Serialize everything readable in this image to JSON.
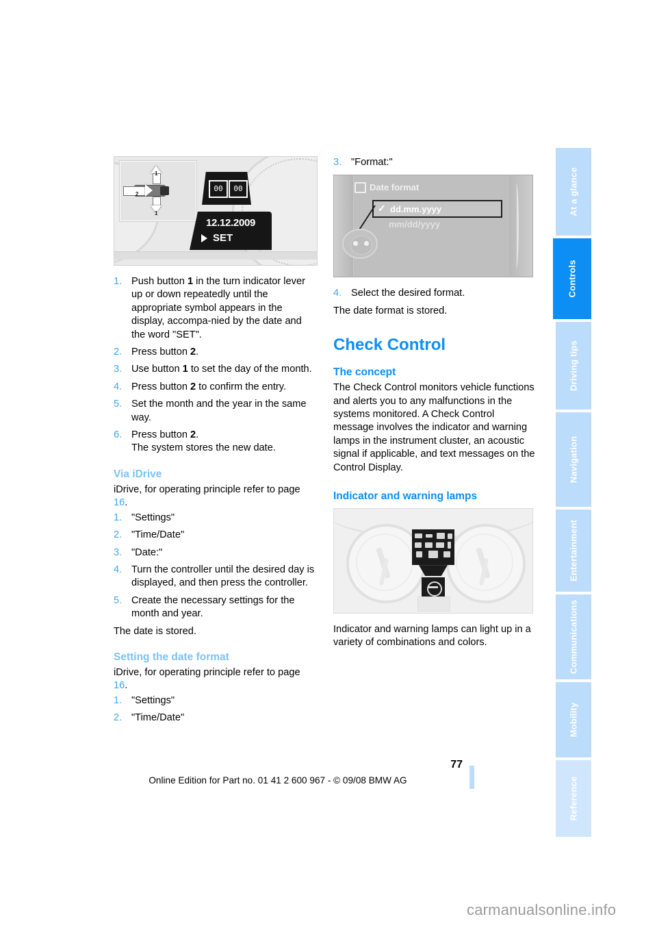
{
  "document": {
    "page_number": "77",
    "footer_text": "Online Edition for Part no. 01 41 2 600 967  - © 09/08 BMW AG",
    "watermark": "carmanualsonline.info"
  },
  "sidebar": {
    "tabs": [
      {
        "label": "At a glance",
        "active": false
      },
      {
        "label": "Controls",
        "active": true
      },
      {
        "label": "Driving tips",
        "active": false
      },
      {
        "label": "Navigation",
        "active": false
      },
      {
        "label": "Entertainment",
        "active": false
      },
      {
        "label": "Communications",
        "active": false
      },
      {
        "label": "Mobility",
        "active": false
      },
      {
        "label": "Reference",
        "active": false
      }
    ],
    "active_color": "#0d8ef5",
    "inactive_color": "#bcdcfb"
  },
  "left_column": {
    "figure1": {
      "caption_code": "",
      "date_display": "12.12.2009",
      "set_label": "SET",
      "clock_left": "00",
      "clock_right": "00",
      "callout_1": "1",
      "callout_1b": "1",
      "callout_2": "2"
    },
    "steps_manual": [
      {
        "num": "1.",
        "text_pre": "Push button ",
        "bold": "1",
        "text_post": " in the turn indicator lever up or down repeatedly until the appropriate symbol appears in the display, accompa-nied by the date and the word \"SET\"."
      },
      {
        "num": "2.",
        "text_pre": "Press button ",
        "bold": "2",
        "text_post": "."
      },
      {
        "num": "3.",
        "text_pre": "Use button ",
        "bold": "1",
        "text_post": " to set the day of the month."
      },
      {
        "num": "4.",
        "text_pre": "Press button ",
        "bold": "2",
        "text_post": " to confirm the entry."
      },
      {
        "num": "5.",
        "text_pre": "Set the month and the year in the same way.",
        "bold": "",
        "text_post": ""
      },
      {
        "num": "6.",
        "text_pre": "Press button ",
        "bold": "2",
        "text_post": ".\nThe system stores the new date."
      }
    ],
    "via_idrive": {
      "heading": "Via iDrive",
      "intro_pre": "iDrive, for operating principle refer to page ",
      "intro_ref": "16",
      "intro_post": ".",
      "steps": [
        {
          "num": "1.",
          "text": "\"Settings\""
        },
        {
          "num": "2.",
          "text": "\"Time/Date\""
        },
        {
          "num": "3.",
          "text": "\"Date:\""
        },
        {
          "num": "4.",
          "text": "Turn the controller until the desired day is displayed, and then press the controller."
        },
        {
          "num": "5.",
          "text": "Create the necessary settings for the month and year."
        }
      ],
      "closing": "The date is stored."
    },
    "date_format": {
      "heading": "Setting the date format",
      "intro_pre": "iDrive, for operating principle refer to page ",
      "intro_ref": "16",
      "intro_post": ".",
      "steps": [
        {
          "num": "1.",
          "text": "\"Settings\""
        },
        {
          "num": "2.",
          "text": "\"Time/Date\""
        }
      ]
    }
  },
  "right_column": {
    "step3": {
      "num": "3.",
      "text": "\"Format:\""
    },
    "figure2": {
      "title": "Date format",
      "option_checked": "dd.mm.yyyy",
      "option_other": "mm/dd/yyyy",
      "check_glyph": "✓"
    },
    "step4": {
      "num": "4.",
      "text": "Select the desired format."
    },
    "after_step4": "The date format is stored.",
    "check_control": {
      "title": "Check Control",
      "concept_heading": "The concept",
      "concept_text": "The Check Control monitors vehicle functions and alerts you to any malfunctions in the systems monitored. A Check Control message involves the indicator and warning lamps in the instrument cluster, an acoustic signal if applicable, and text messages on the Control Display."
    },
    "lamps": {
      "heading": "Indicator and warning lamps",
      "caption": "Indicator and warning lamps can light up in a variety of combinations and colors."
    }
  }
}
